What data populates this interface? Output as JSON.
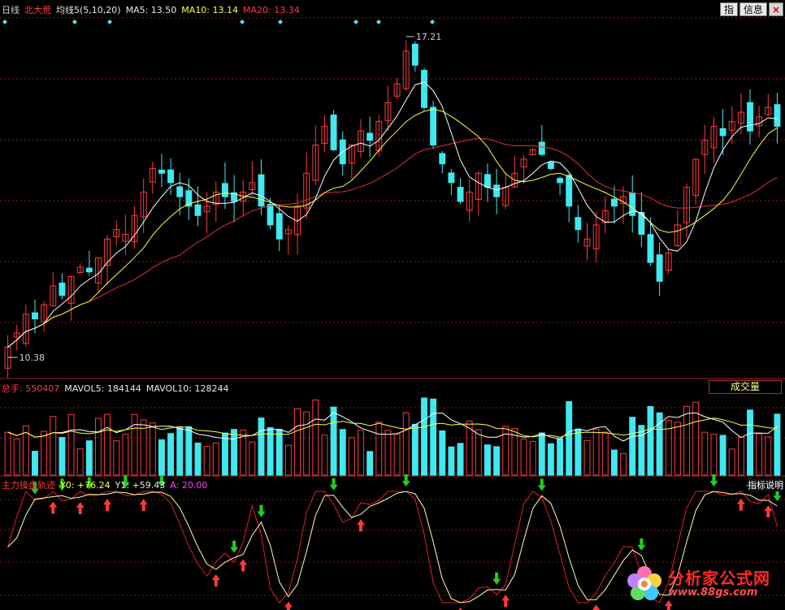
{
  "header": {
    "period": "日线",
    "stock": "北大荒",
    "indicator": "均线5(5,10,20)",
    "ma5": "MA5: 13.50",
    "ma10": "MA10: 13.14",
    "ma20": "MA20: 13.34",
    "btn_zhi": "指",
    "btn_info": "信息",
    "btn_close": "×"
  },
  "price_panel": {
    "high_label": "17.21",
    "low_label": "10.38"
  },
  "volume_panel": {
    "total": "总手: 550407",
    "mavol5": "MAVOL5: 184144",
    "mavol10": "MAVOL10: 128244",
    "button": "成交量"
  },
  "indicator_panel": {
    "name": "主力操盘轨迹",
    "y0": "Y0: +76.24",
    "y1": "Y1: +59.43",
    "a": "A: 20.00",
    "button": "指标说明"
  },
  "watermark": {
    "title": "分析家公式网",
    "url": "www.88gs.com"
  },
  "colors": {
    "up": "#ff3a3a",
    "down": "#40e8f0",
    "ma5": "#ffffff",
    "ma10": "#ffff40",
    "ma20": "#e03030",
    "grid": "#8a1a1a",
    "arrow_up": "#ff3a3a",
    "arrow_down": "#20d020"
  },
  "chart_data": {
    "type": "line",
    "price_min": 10.38,
    "price_max": 17.21,
    "close": [
      10.6,
      10.9,
      11.3,
      11.2,
      11.5,
      11.9,
      11.7,
      12.1,
      12.3,
      12.2,
      12.5,
      12.9,
      13.1,
      13.0,
      13.4,
      13.9,
      14.4,
      14.3,
      14.1,
      13.8,
      13.6,
      13.4,
      13.6,
      13.9,
      13.8,
      13.7,
      13.9,
      14.1,
      13.6,
      13.2,
      12.9,
      13.1,
      13.6,
      14.3,
      14.9,
      15.3,
      14.8,
      14.5,
      14.9,
      15.2,
      15.0,
      15.4,
      15.8,
      16.2,
      16.9,
      16.6,
      15.7,
      14.9,
      14.5,
      14.1,
      13.7,
      13.9,
      14.3,
      14.0,
      13.8,
      14.0,
      14.3,
      14.6,
      14.8,
      14.7,
      14.4,
      14.1,
      13.6,
      13.1,
      12.9,
      13.2,
      13.5,
      13.6,
      13.8,
      13.4,
      13.0,
      12.4,
      12.0,
      12.6,
      13.2,
      14.0,
      14.6,
      15.0,
      15.3,
      15.1,
      15.4,
      15.6,
      15.2,
      15.5,
      15.7,
      15.3
    ]
  }
}
